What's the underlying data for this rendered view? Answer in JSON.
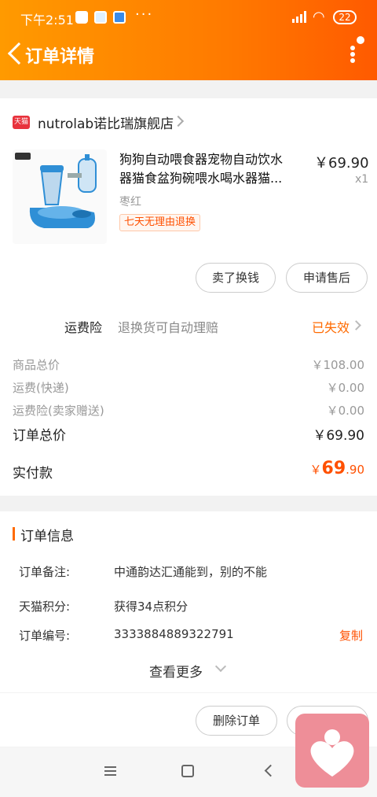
{
  "status_bar": {
    "time": "下午2:51",
    "more": "···",
    "network": "HD",
    "battery": "22"
  },
  "header": {
    "title": "订单详情"
  },
  "shop": {
    "badge": "天猫",
    "name": "nutrolab诺比瑞旗舰店"
  },
  "product": {
    "name_line1": "狗狗自动喂食器宠物自动饮水",
    "name_line2": "器猫食盆狗碗喂水喝水器猫...",
    "price": "￥69.90",
    "quantity": "x1",
    "variant": "枣红",
    "badge": "七天无理由退换"
  },
  "product_actions": {
    "sell": "卖了换钱",
    "aftersale": "申请售后"
  },
  "insurance": {
    "label": "运费险",
    "desc": "退换货可自动理赔",
    "status": "已失效"
  },
  "fees": [
    {
      "label": "商品总价",
      "value": "￥108.00"
    },
    {
      "label": "运费(快递)",
      "value": "￥0.00"
    },
    {
      "label": "运费险(卖家赠送)",
      "value": "￥0.00"
    }
  ],
  "total": {
    "label": "订单总价",
    "value": "￥69.90"
  },
  "paid": {
    "label": "实付款",
    "symbol": "￥",
    "int": "69",
    "dec": ".90"
  },
  "order_info": {
    "title": "订单信息",
    "rows": [
      {
        "label": "订单备注:",
        "value": "中通韵达汇通能到，别的不能"
      },
      {
        "label": "天猫积分:",
        "value": "获得34点积分"
      },
      {
        "label": "订单编号:",
        "value": "3333884889322791"
      }
    ],
    "copy": "复制",
    "more": "查看更多"
  },
  "bottom_actions": {
    "delete": "删除订单"
  },
  "colors": {
    "header_start": "#ff9a00",
    "header_end": "#ff5a00",
    "accent": "#ff5000"
  }
}
